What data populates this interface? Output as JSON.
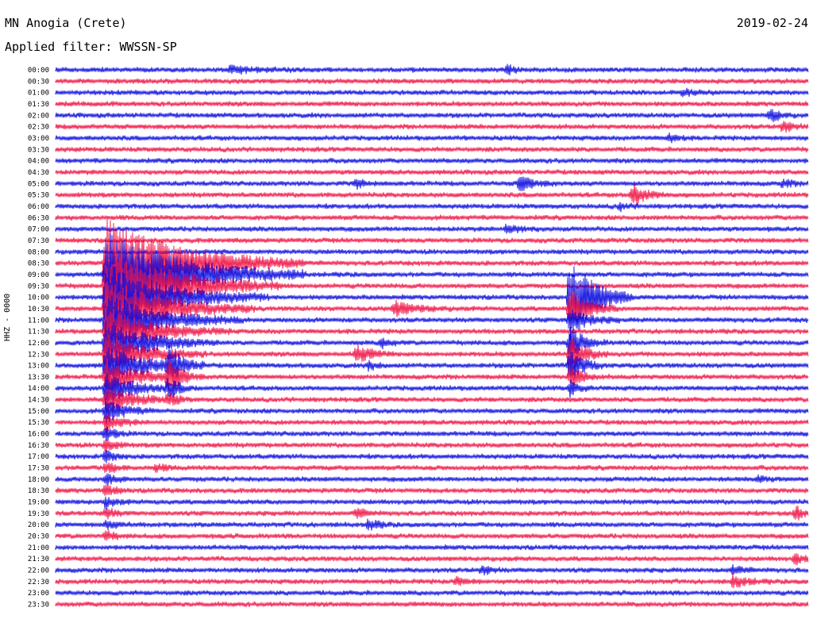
{
  "header": {
    "station": "MN Anogia (Crete)",
    "date": "2019-02-24",
    "filter": "Applied filter: WWSSN-SP"
  },
  "axis": {
    "channel_label": "HHZ - 0000"
  },
  "colors": {
    "even": "#1010e0",
    "odd": "#f0184a",
    "background": "#ffffff"
  },
  "chart_data": {
    "type": "line",
    "title": "MN Anogia (Crete)",
    "subtitle": "Applied filter: WWSSN-SP",
    "ylabel": "HHZ - 0000",
    "xlabel": "",
    "grid": false,
    "legend": "none",
    "trace_minutes": 30,
    "colors_alternate": [
      "#1010e0",
      "#f0184a"
    ],
    "rows": [
      "00:00",
      "00:30",
      "01:00",
      "01:30",
      "02:00",
      "02:30",
      "03:00",
      "03:30",
      "04:00",
      "04:30",
      "05:00",
      "05:30",
      "06:00",
      "06:30",
      "07:00",
      "07:30",
      "08:00",
      "08:30",
      "09:00",
      "09:30",
      "10:00",
      "10:30",
      "11:00",
      "11:30",
      "12:00",
      "12:30",
      "13:00",
      "13:30",
      "14:00",
      "14:30",
      "15:00",
      "15:30",
      "16:00",
      "16:30",
      "17:00",
      "17:30",
      "18:00",
      "18:30",
      "19:00",
      "19:30",
      "20:00",
      "20:30",
      "21:00",
      "21:30",
      "22:00",
      "22:30",
      "23:00",
      "23:30"
    ],
    "events": [
      {
        "row": 0,
        "minute": 7.0,
        "amp": 5,
        "dur": 2.5
      },
      {
        "row": 0,
        "minute": 18.0,
        "amp": 7,
        "dur": 0.8
      },
      {
        "row": 2,
        "minute": 25.0,
        "amp": 4,
        "dur": 1.5
      },
      {
        "row": 4,
        "minute": 28.5,
        "amp": 9,
        "dur": 1.0
      },
      {
        "row": 5,
        "minute": 29.0,
        "amp": 8,
        "dur": 1.0
      },
      {
        "row": 6,
        "minute": 24.5,
        "amp": 6,
        "dur": 0.8
      },
      {
        "row": 10,
        "minute": 12.0,
        "amp": 6,
        "dur": 0.8
      },
      {
        "row": 10,
        "minute": 18.5,
        "amp": 10,
        "dur": 1.5
      },
      {
        "row": 10,
        "minute": 29.0,
        "amp": 5,
        "dur": 1.0
      },
      {
        "row": 11,
        "minute": 23.0,
        "amp": 14,
        "dur": 1.5
      },
      {
        "row": 14,
        "minute": 18.0,
        "amp": 6,
        "dur": 1.5
      },
      {
        "row": 21,
        "minute": 4.0,
        "amp": 5,
        "dur": 1.0
      },
      {
        "row": 21,
        "minute": 13.5,
        "amp": 9,
        "dur": 2.5
      },
      {
        "row": 20,
        "minute": 20.5,
        "amp": 60,
        "dur": 2.5
      },
      {
        "row": 21,
        "minute": 20.5,
        "amp": 25,
        "dur": 2.0
      },
      {
        "row": 22,
        "minute": 20.5,
        "amp": 15,
        "dur": 2.0
      },
      {
        "row": 24,
        "minute": 20.5,
        "amp": 20,
        "dur": 1.5
      },
      {
        "row": 25,
        "minute": 20.5,
        "amp": 25,
        "dur": 1.5
      },
      {
        "row": 26,
        "minute": 20.5,
        "amp": 20,
        "dur": 1.5
      },
      {
        "row": 27,
        "minute": 20.5,
        "amp": 15,
        "dur": 1.2
      },
      {
        "row": 28,
        "minute": 20.5,
        "amp": 10,
        "dur": 1.0
      },
      {
        "row": 24,
        "minute": 13.0,
        "amp": 6,
        "dur": 1.0
      },
      {
        "row": 25,
        "minute": 12.0,
        "amp": 12,
        "dur": 1.5
      },
      {
        "row": 26,
        "minute": 12.5,
        "amp": 6,
        "dur": 1.0
      },
      {
        "row": 17,
        "minute": 2.0,
        "amp": 60,
        "dur": 8.0
      },
      {
        "row": 18,
        "minute": 2.0,
        "amp": 60,
        "dur": 8.0
      },
      {
        "row": 19,
        "minute": 2.0,
        "amp": 55,
        "dur": 7.0
      },
      {
        "row": 20,
        "minute": 2.0,
        "amp": 45,
        "dur": 6.5
      },
      {
        "row": 21,
        "minute": 2.0,
        "amp": 40,
        "dur": 6.0
      },
      {
        "row": 22,
        "minute": 2.0,
        "amp": 35,
        "dur": 5.5
      },
      {
        "row": 23,
        "minute": 2.0,
        "amp": 30,
        "dur": 5.0
      },
      {
        "row": 24,
        "minute": 2.0,
        "amp": 30,
        "dur": 4.5
      },
      {
        "row": 25,
        "minute": 2.0,
        "amp": 28,
        "dur": 4.0
      },
      {
        "row": 26,
        "minute": 2.0,
        "amp": 25,
        "dur": 4.0
      },
      {
        "row": 27,
        "minute": 2.0,
        "amp": 22,
        "dur": 3.5
      },
      {
        "row": 28,
        "minute": 2.0,
        "amp": 20,
        "dur": 3.0
      },
      {
        "row": 29,
        "minute": 2.0,
        "amp": 18,
        "dur": 3.0
      },
      {
        "row": 30,
        "minute": 2.0,
        "amp": 15,
        "dur": 2.0
      },
      {
        "row": 31,
        "minute": 2.0,
        "amp": 12,
        "dur": 1.5
      },
      {
        "row": 32,
        "minute": 2.0,
        "amp": 10,
        "dur": 1.0
      },
      {
        "row": 33,
        "minute": 2.0,
        "amp": 9,
        "dur": 1.0
      },
      {
        "row": 34,
        "minute": 2.0,
        "amp": 8,
        "dur": 1.0
      },
      {
        "row": 35,
        "minute": 2.0,
        "amp": 8,
        "dur": 1.0
      },
      {
        "row": 36,
        "minute": 2.0,
        "amp": 7,
        "dur": 1.0
      },
      {
        "row": 37,
        "minute": 2.0,
        "amp": 7,
        "dur": 1.0
      },
      {
        "row": 38,
        "minute": 2.0,
        "amp": 7,
        "dur": 1.0
      },
      {
        "row": 39,
        "minute": 2.0,
        "amp": 7,
        "dur": 1.0
      },
      {
        "row": 40,
        "minute": 2.0,
        "amp": 6,
        "dur": 1.0
      },
      {
        "row": 41,
        "minute": 2.0,
        "amp": 6,
        "dur": 1.0
      },
      {
        "row": 26,
        "minute": 4.5,
        "amp": 22,
        "dur": 1.5
      },
      {
        "row": 27,
        "minute": 4.5,
        "amp": 18,
        "dur": 1.5
      },
      {
        "row": 28,
        "minute": 4.5,
        "amp": 12,
        "dur": 1.2
      },
      {
        "row": 29,
        "minute": 4.5,
        "amp": 8,
        "dur": 1.0
      },
      {
        "row": 35,
        "minute": 4.0,
        "amp": 5,
        "dur": 1.0
      },
      {
        "row": 39,
        "minute": 12.0,
        "amp": 6,
        "dur": 1.0
      },
      {
        "row": 40,
        "minute": 12.5,
        "amp": 7,
        "dur": 1.0
      },
      {
        "row": 44,
        "minute": 17.0,
        "amp": 6,
        "dur": 1.0
      },
      {
        "row": 45,
        "minute": 16.0,
        "amp": 6,
        "dur": 1.0
      },
      {
        "row": 44,
        "minute": 27.0,
        "amp": 6,
        "dur": 1.0
      },
      {
        "row": 45,
        "minute": 27.0,
        "amp": 8,
        "dur": 1.5
      },
      {
        "row": 39,
        "minute": 29.5,
        "amp": 8,
        "dur": 1.0
      },
      {
        "row": 43,
        "minute": 29.5,
        "amp": 7,
        "dur": 1.0
      },
      {
        "row": 36,
        "minute": 28.0,
        "amp": 4,
        "dur": 1.0
      },
      {
        "row": 12,
        "minute": 22.5,
        "amp": 5,
        "dur": 0.8
      }
    ]
  }
}
